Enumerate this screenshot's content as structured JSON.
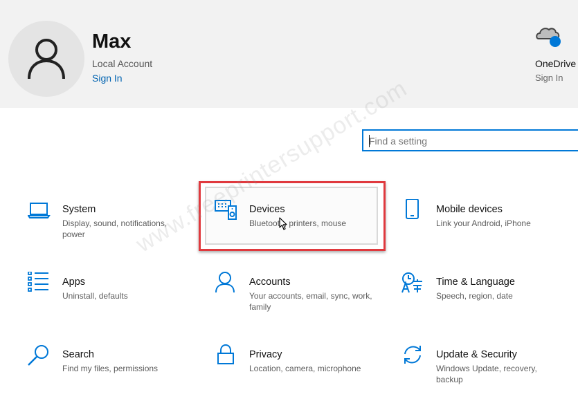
{
  "header": {
    "user_name": "Max",
    "account_type": "Local Account",
    "sign_in": "Sign In",
    "onedrive": {
      "label": "OneDrive",
      "sub": "Sign In"
    }
  },
  "search": {
    "placeholder": "Find a setting",
    "value": ""
  },
  "tiles": [
    {
      "icon": "laptop-icon",
      "title": "System",
      "desc": "Display, sound, notifications, power"
    },
    {
      "icon": "keyboard-speaker-icon",
      "title": "Devices",
      "desc": "Bluetooth, printers, mouse"
    },
    {
      "icon": "phone-icon",
      "title": "Mobile devices",
      "desc": "Link your Android, iPhone"
    },
    {
      "icon": "apps-list-icon",
      "title": "Apps",
      "desc": "Uninstall, defaults"
    },
    {
      "icon": "person-icon",
      "title": "Accounts",
      "desc": "Your accounts, email, sync, work, family"
    },
    {
      "icon": "time-language-icon",
      "title": "Time & Language",
      "desc": "Speech, region, date"
    },
    {
      "icon": "search-icon",
      "title": "Search",
      "desc": "Find my files, permissions"
    },
    {
      "icon": "lock-icon",
      "title": "Privacy",
      "desc": "Location, camera, microphone"
    },
    {
      "icon": "sync-icon",
      "title": "Update & Security",
      "desc": "Windows Update, recovery, backup"
    }
  ],
  "watermark": "www.freeprintersupport.com",
  "colors": {
    "accent": "#0078d7",
    "highlight": "#e0393e",
    "header_bg": "#f2f2f2"
  }
}
